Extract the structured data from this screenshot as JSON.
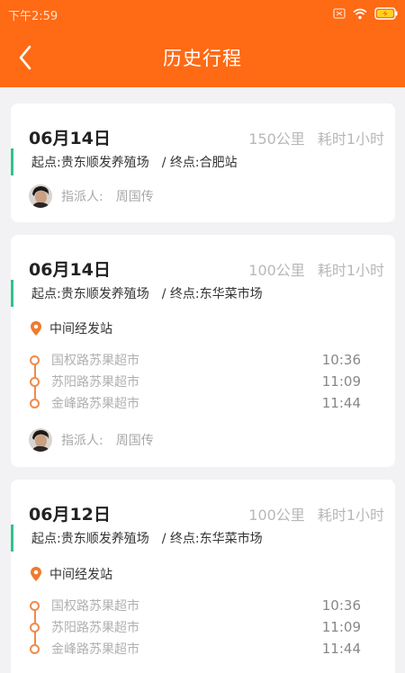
{
  "status_bar": {
    "time": "下午2:59"
  },
  "header": {
    "title": "历史行程"
  },
  "labels": {
    "start_prefix": "起点:",
    "end_prefix": "/ 终点:",
    "assignee_label": "指派人:",
    "transit_title": "中间经发站"
  },
  "trips": [
    {
      "date": "06月14日",
      "distance": "150公里",
      "duration": "耗时1小时",
      "start": "贵东顺发养殖场",
      "end": "合肥站",
      "assignee": "周国传",
      "stops": []
    },
    {
      "date": "06月14日",
      "distance": "100公里",
      "duration": "耗时1小时",
      "start": "贵东顺发养殖场",
      "end": "东华菜市场",
      "assignee": "周国传",
      "stops": [
        {
          "name": "国权路苏果超市",
          "time": "10:36"
        },
        {
          "name": "苏阳路苏果超市",
          "time": "11:09"
        },
        {
          "name": "金峰路苏果超市",
          "time": "11:44"
        }
      ]
    },
    {
      "date": "06月12日",
      "distance": "100公里",
      "duration": "耗时1小时",
      "start": "贵东顺发养殖场",
      "end": "东华菜市场",
      "assignee": "",
      "stops": [
        {
          "name": "国权路苏果超市",
          "time": "10:36"
        },
        {
          "name": "苏阳路苏果超市",
          "time": "11:09"
        },
        {
          "name": "金峰路苏果超市",
          "time": "11:44"
        }
      ]
    }
  ],
  "colors": {
    "header": "#ff6a14",
    "route_bar": "#2fc28b",
    "stop": "#f08b4a"
  },
  "icons": {
    "back": "chevron-left-icon",
    "location": "location-pin-icon",
    "avatar": "avatar"
  }
}
